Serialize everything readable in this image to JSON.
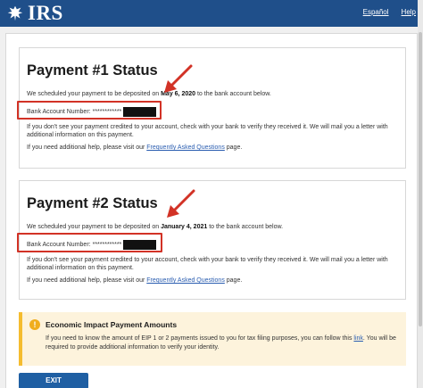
{
  "header": {
    "logo_text": "IRS",
    "espanol_label": "Español",
    "help_label": "Help"
  },
  "payment1": {
    "title": "Payment #1 Status",
    "sched_prefix": "We scheduled your payment to be deposited on ",
    "sched_date": "May 6, 2020",
    "sched_suffix": " to the bank account below.",
    "account_label": "Bank Account Number: ",
    "account_mask": "************",
    "mail_text": "If you don't see your payment credited to your account, check with your bank to verify they received it. We will mail you a letter with additional information on this payment.",
    "help_prefix": "If you need additional help, please visit our ",
    "help_link": "Frequently Asked Questions",
    "help_suffix": " page."
  },
  "payment2": {
    "title": "Payment #2 Status",
    "sched_prefix": "We scheduled your payment to be deposited on ",
    "sched_date": "January 4, 2021",
    "sched_suffix": " to the bank account below.",
    "account_label": "Bank Account Number: ",
    "account_mask": "************",
    "mail_text": "If you don't see your payment credited to your account, check with your bank to verify they received it. We will mail you a letter with additional information on this payment.",
    "help_prefix": "If you need additional help, please visit our ",
    "help_link": "Frequently Asked Questions",
    "help_suffix": " page."
  },
  "notice": {
    "title": "Economic Impact Payment Amounts",
    "body_prefix": "If you need to know the amount of EIP 1 or 2 payments issued to you for tax filing purposes, you can follow this ",
    "body_link": "link",
    "body_suffix": ". You will be required to provide additional information to verify your identity."
  },
  "exit_label": "EXIT",
  "colors": {
    "header_blue": "#1f4f8a",
    "highlight_red": "#d23226",
    "notice_yellow": "#f5bc2f",
    "link_blue": "#2a5db0"
  }
}
